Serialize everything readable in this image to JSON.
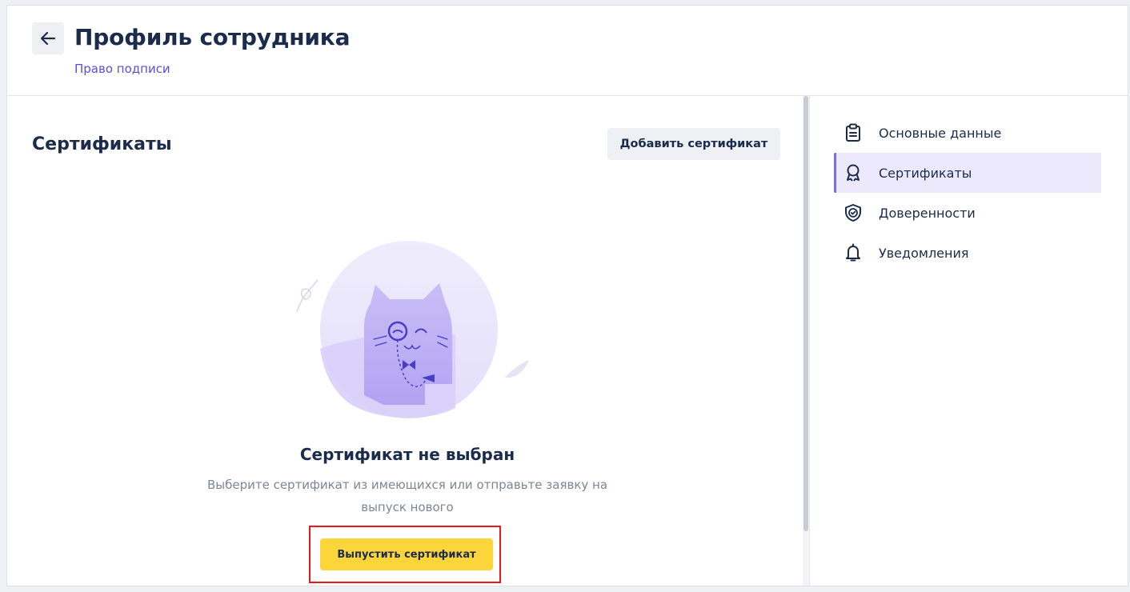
{
  "header": {
    "back_icon": "arrow-left-icon",
    "title": "Профиль сотрудника",
    "breadcrumb": "Право подписи"
  },
  "main": {
    "section_title": "Сертификаты",
    "add_button": "Добавить сертификат",
    "empty_state": {
      "illustration": "cat-with-monocle-illustration",
      "title": "Сертификат не выбран",
      "description": "Выберите сертификат из имеющихся или отправьте заявку на выпуск нового",
      "action_button": "Выпустить сертификат"
    }
  },
  "sidebar": {
    "items": [
      {
        "label": "Основные данные",
        "icon": "clipboard-icon",
        "active": false
      },
      {
        "label": "Сертификаты",
        "icon": "award-icon",
        "active": true
      },
      {
        "label": "Доверенности",
        "icon": "shield-check-icon",
        "active": false
      },
      {
        "label": "Уведомления",
        "icon": "bell-icon",
        "active": false
      }
    ]
  },
  "colors": {
    "accent": "#5a4fd6",
    "primary_button": "#fcd53a",
    "highlight": "#e31b1b",
    "active_nav_bg": "#ece9fc"
  }
}
